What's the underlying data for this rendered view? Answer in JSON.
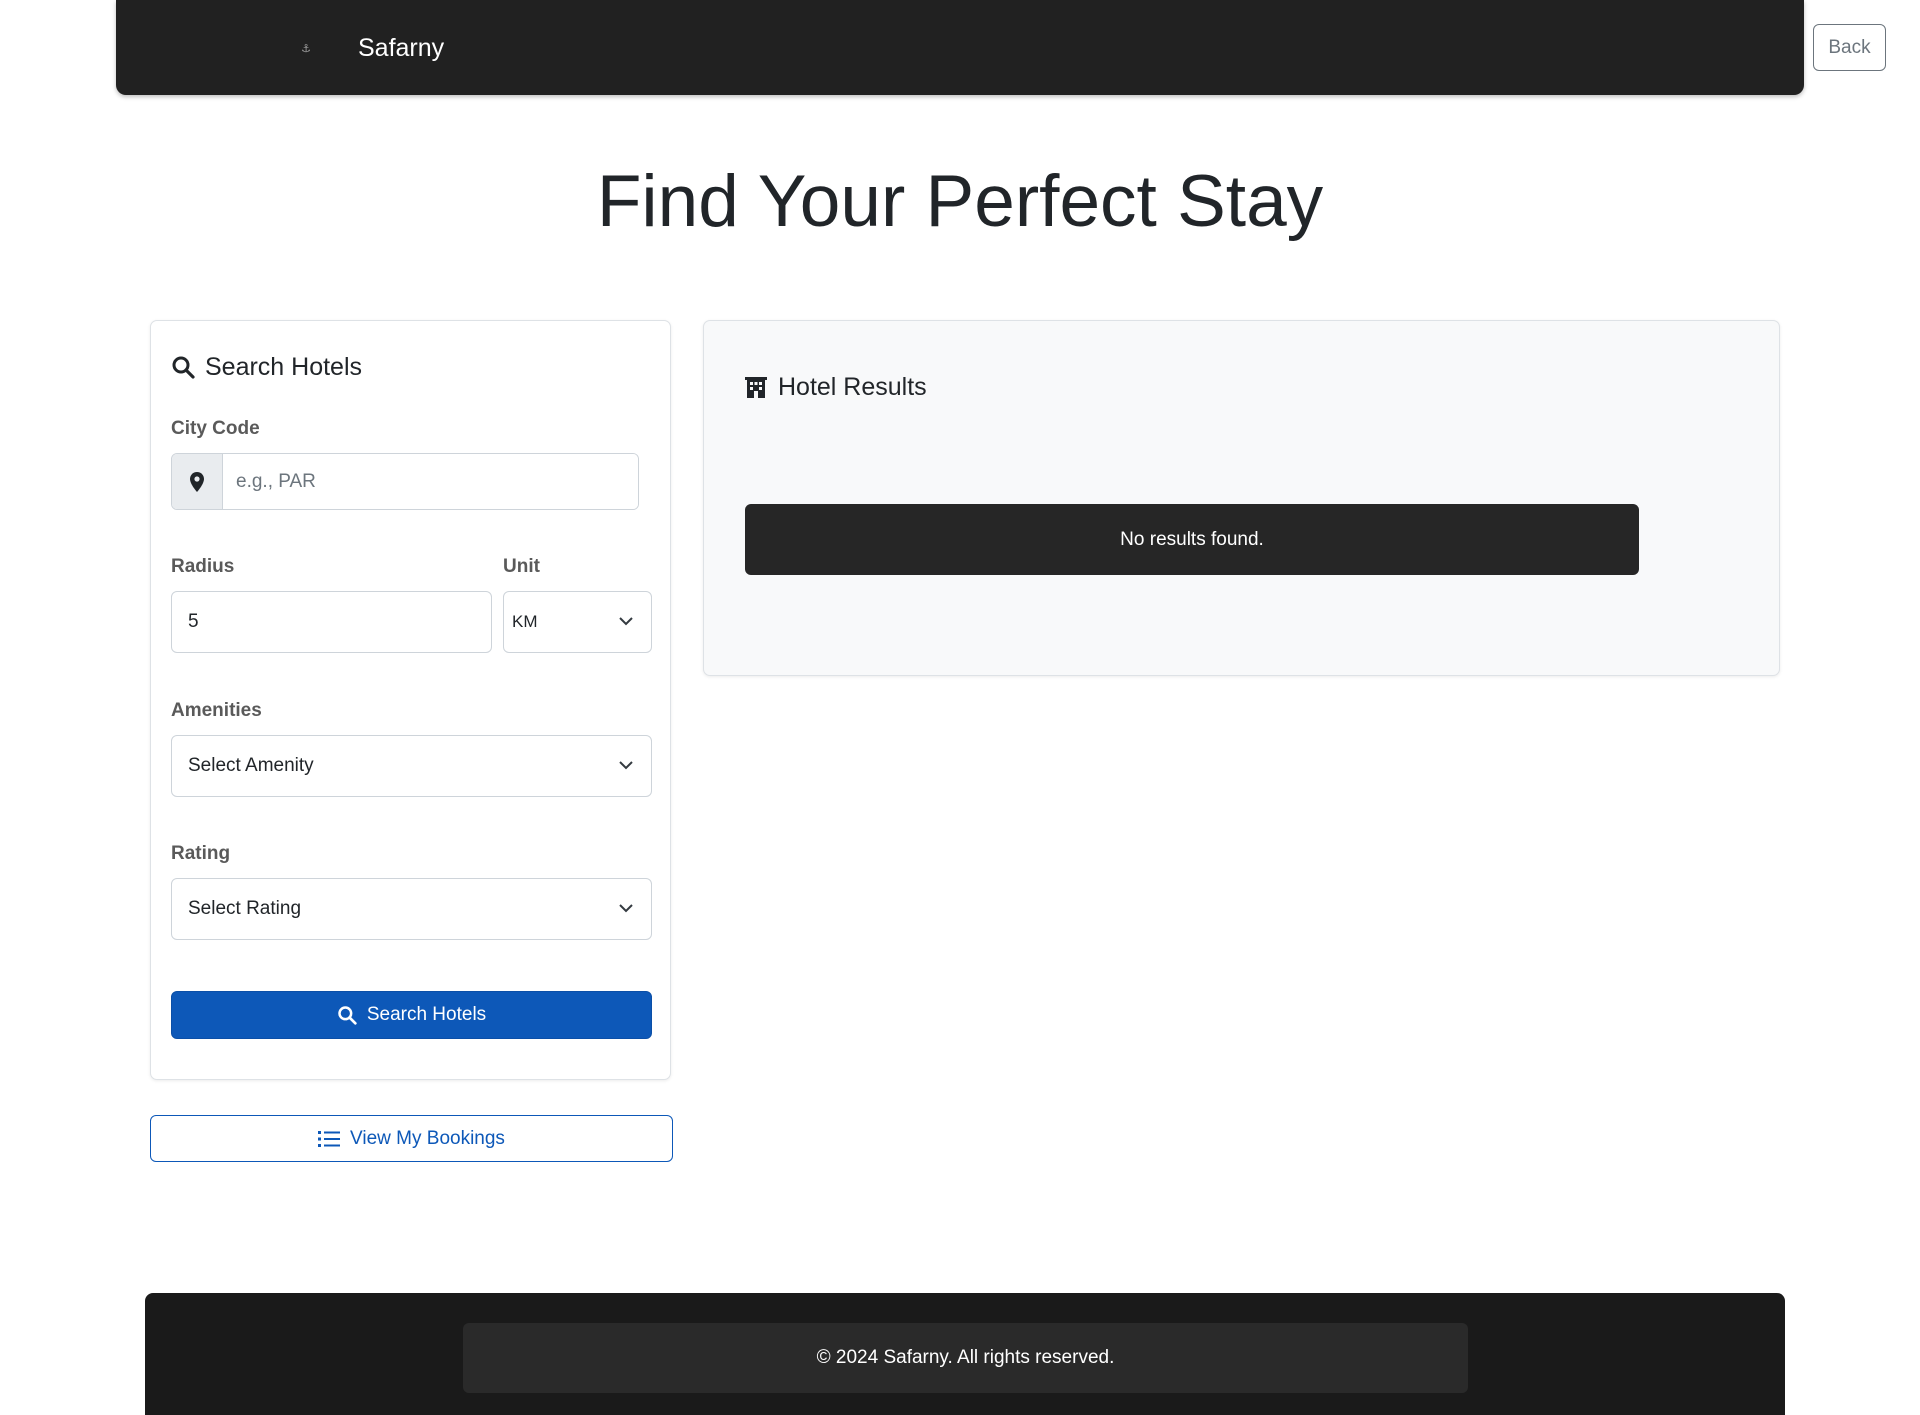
{
  "navbar": {
    "logo_glyph": "⚓",
    "brand": "Safarny",
    "back_label": "Back"
  },
  "page": {
    "title": "Find Your Perfect Stay"
  },
  "search_form": {
    "title": "Search Hotels",
    "city_code": {
      "label": "City Code",
      "value": "",
      "placeholder": "e.g., PAR",
      "icon": "map-pin-icon"
    },
    "radius": {
      "label": "Radius",
      "value": "5"
    },
    "unit": {
      "label": "Unit",
      "selected": "KM"
    },
    "amenities": {
      "label": "Amenities",
      "selected": "Select Amenity"
    },
    "rating": {
      "label": "Rating",
      "selected": "Select Rating"
    },
    "submit_label": "Search Hotels"
  },
  "bookings_button": {
    "label": "View My Bookings",
    "icon": "list-icon"
  },
  "results": {
    "title": "Hotel Results",
    "icon": "building-icon",
    "empty_message": "No results found."
  },
  "footer": {
    "text": "© 2024 Safarny. All rights reserved."
  },
  "colors": {
    "navbar_bg": "#212121",
    "primary": "#0d58b8",
    "alert_bg": "#262626",
    "footer_bg": "#1a1a1a"
  }
}
